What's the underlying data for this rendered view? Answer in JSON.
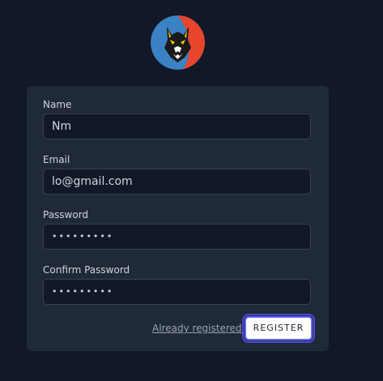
{
  "logo": {
    "icon": "wolf-logo-icon",
    "colors": [
      "#3b82c4",
      "#e8452c"
    ]
  },
  "form": {
    "fields": [
      {
        "label": "Name",
        "value": "Nm"
      },
      {
        "label": "Email",
        "value": "lo@gmail.com"
      },
      {
        "label": "Password",
        "value": "•••••••••"
      },
      {
        "label": "Confirm Password",
        "value": "•••••••••"
      }
    ],
    "login_link": "Already registered?",
    "submit_label": "REGISTER"
  },
  "colors": {
    "background": "#111827",
    "card": "#1f2937",
    "input": "#111827",
    "focus_ring": "#6366f1"
  }
}
